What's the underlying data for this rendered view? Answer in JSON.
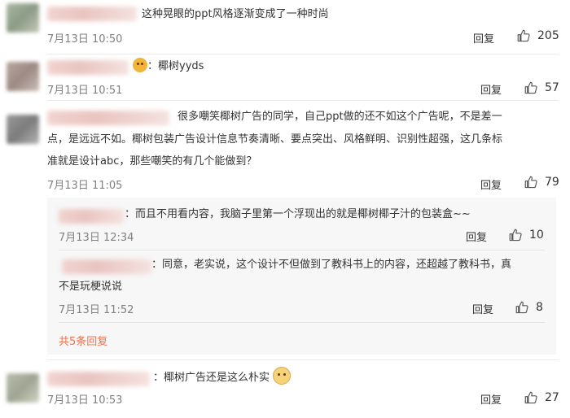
{
  "comments": [
    {
      "text": "这种晃眼的ppt风格逐渐变成了一种时尚",
      "date": "7月13日 10:50",
      "reply_label": "回复",
      "likes": "205"
    },
    {
      "text_prefix": "：椰树yyds",
      "date": "7月13日 10:51",
      "reply_label": "回复",
      "likes": "57"
    },
    {
      "line1": "很多嘲笑椰树广告的同学，自己ppt做的还不如这个广告呢，不是差一",
      "line2": "点，是远远不如。椰树包装广告设计信息节奏清晰、要点突出、风格鲜明、识别性超强，这几条标",
      "line3": "准就是设计abc，那些嘲笑的有几个能做到？",
      "date": "7月13日 11:05",
      "reply_label": "回复",
      "likes": "79",
      "replies": [
        {
          "text": "：而且不用看内容，我脑子里第一个浮现出的就是椰树椰子汁的包装盒~~",
          "date": "7月13日 12:34",
          "reply_label": "回复",
          "likes": "10"
        },
        {
          "line1": "：同意，老实说，这个设计不但做到了教科书上的内容，还超越了教科书，真",
          "line2": "不是玩梗说说",
          "date": "7月13日 11:52",
          "reply_label": "回复",
          "likes": "8"
        }
      ],
      "more_replies": "共5条回复"
    },
    {
      "text": "：椰树广告还是这么朴实",
      "date": "7月13日 10:53",
      "reply_label": "回复",
      "likes": "27"
    }
  ],
  "colors": {
    "accent": "#eb7350",
    "meta": "#808080",
    "divider": "#ebebeb",
    "reply_box": "#f7f7f7"
  },
  "icons": {
    "like": "thumbs-up-icon",
    "emoji_1": "smiling-face-emoji-icon",
    "emoji_2": "dog-face-emoji-icon"
  }
}
